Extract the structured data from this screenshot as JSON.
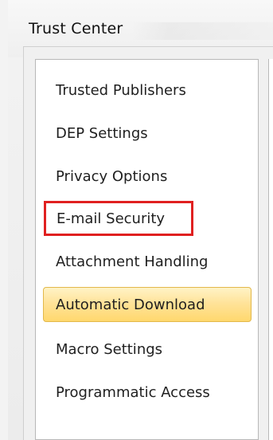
{
  "window": {
    "title": "Trust Center"
  },
  "sidebar": {
    "items": [
      {
        "label": "Trusted Publishers"
      },
      {
        "label": "DEP Settings"
      },
      {
        "label": "Privacy Options"
      },
      {
        "label": "E-mail Security",
        "highlighted": true
      },
      {
        "label": "Attachment Handling"
      },
      {
        "label": "Automatic Download",
        "selected": true
      },
      {
        "label": "Macro Settings"
      },
      {
        "label": "Programmatic Access"
      }
    ]
  },
  "colors": {
    "selection_border": "#e2b84b",
    "selection_fill_top": "#fff3c6",
    "selection_fill_bottom": "#ffd86e",
    "highlight_red": "#e02020"
  }
}
